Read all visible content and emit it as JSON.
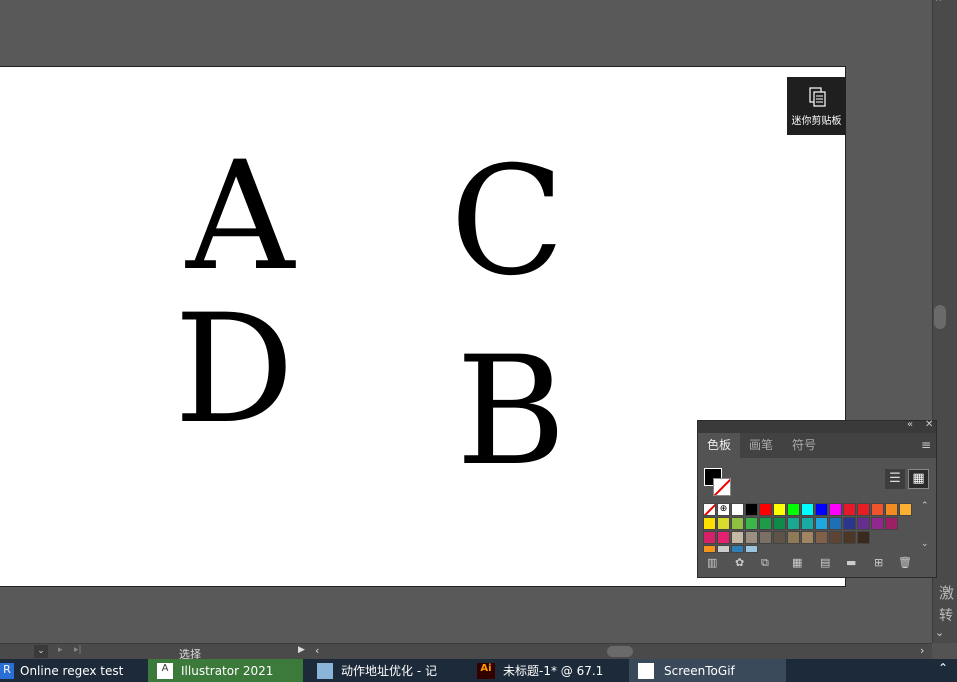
{
  "canvas": {
    "letters": [
      "A",
      "C",
      "D",
      "B"
    ]
  },
  "clipboard_panel": {
    "label": "迷你剪贴板"
  },
  "side_text": [
    "激",
    "转"
  ],
  "status_bar": {
    "tool_label": "选择"
  },
  "swatch_panel": {
    "tabs": [
      "色板",
      "画笔",
      "符号"
    ],
    "colors": {
      "fill": "#000000",
      "row1": [
        "#ffffff",
        "#000000",
        "#ff0000",
        "#ffff00",
        "#00ff00",
        "#00ffff",
        "#0000ff",
        "#ff00ff",
        "#e8182b",
        "#e51d24",
        "#f0542a",
        "#f48b20",
        "#fbb033"
      ],
      "row2": [
        "#ffe000",
        "#d8dc2c",
        "#8fc03f",
        "#3cb54a",
        "#1d9c48",
        "#0f8a4a",
        "#1ba891",
        "#18aaa5",
        "#1fa6df",
        "#1e6fb6",
        "#2b3690",
        "#662e8f",
        "#92278f",
        "#9e1f63"
      ],
      "row3": [
        "#d62068",
        "#e5206e",
        "#c5b8a5",
        "#9b8f82",
        "#7c6f63",
        "#5f5248",
        "#8f7a57",
        "#a08560",
        "#7e6148",
        "#5e4533",
        "#4c3625",
        "#3a2a1e"
      ],
      "row4": [
        "#f7941d",
        "#cccccc",
        "#2e7fb8",
        "#9bc6e0"
      ]
    }
  },
  "taskbar": {
    "items": [
      "Online regex test",
      "Illustrator 2021",
      "动作地址优化 - 记",
      "未标题-1* @ 67.1",
      "ScreenToGif"
    ]
  }
}
